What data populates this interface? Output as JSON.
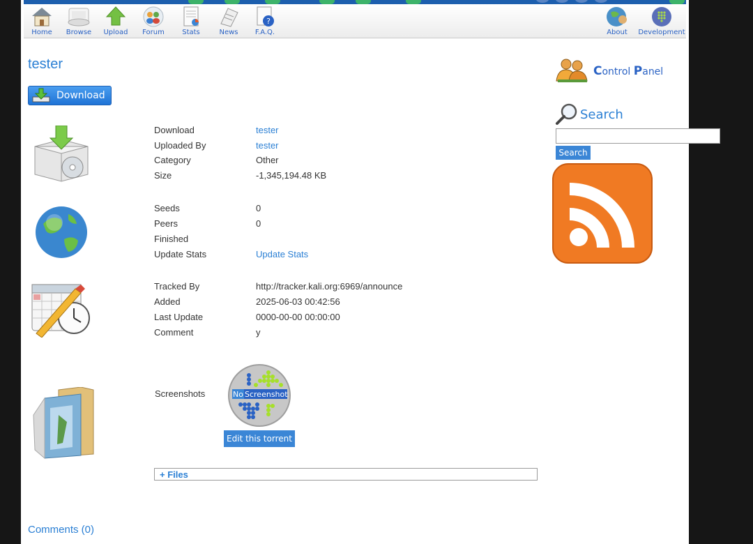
{
  "nav": {
    "items": [
      {
        "label": "Home",
        "icon": "home-icon"
      },
      {
        "label": "Browse",
        "icon": "browse-icon"
      },
      {
        "label": "Upload",
        "icon": "upload-icon"
      },
      {
        "label": "Forum",
        "icon": "forum-icon"
      },
      {
        "label": "Stats",
        "icon": "stats-icon"
      },
      {
        "label": "News",
        "icon": "news-icon"
      },
      {
        "label": "F.A.Q.",
        "icon": "faq-icon"
      },
      {
        "label": "About",
        "icon": "about-icon"
      },
      {
        "label": "Development",
        "icon": "development-icon"
      }
    ]
  },
  "torrent": {
    "title": "tester",
    "download_button": "Download",
    "details": [
      {
        "label": "Download",
        "value": "tester"
      },
      {
        "label": "Uploaded By",
        "value": "tester"
      },
      {
        "label": "Category",
        "value": "Other"
      },
      {
        "label": "Size",
        "value": "-1,345,194.48 KB"
      }
    ],
    "stats": [
      {
        "label": "Seeds",
        "value": "0"
      },
      {
        "label": "Peers",
        "value": "0"
      },
      {
        "label": "Finished",
        "value": ""
      },
      {
        "label": "Update Stats",
        "value": "Update Stats"
      }
    ],
    "tracking": [
      {
        "label": "Tracked By",
        "value": "http://tracker.kali.org:6969/announce"
      },
      {
        "label": "Added",
        "value": "2025-06-03 00:42:56"
      },
      {
        "label": "Last Update",
        "value": "0000-00-00 00:00:00"
      },
      {
        "label": "Comment",
        "value": "y"
      }
    ],
    "screenshots_label": "Screenshots",
    "no_screenshot_prefix": "No",
    "no_screenshot_word": "Screenshot",
    "edit_button": "Edit this torrent",
    "files_toggle": "+ Files",
    "comments": "Comments (0)"
  },
  "sidebar": {
    "control_panel": {
      "first_c": "C",
      "rest_1": "ontrol ",
      "first_p": "P",
      "rest_2": "anel"
    },
    "search_title": "Search",
    "search_placeholder": "",
    "search_button": "Search"
  },
  "colors": {
    "link": "#2a7fd4",
    "button": "#3b86d6",
    "banner": "#1d5fae",
    "rss": "#f07a23"
  }
}
